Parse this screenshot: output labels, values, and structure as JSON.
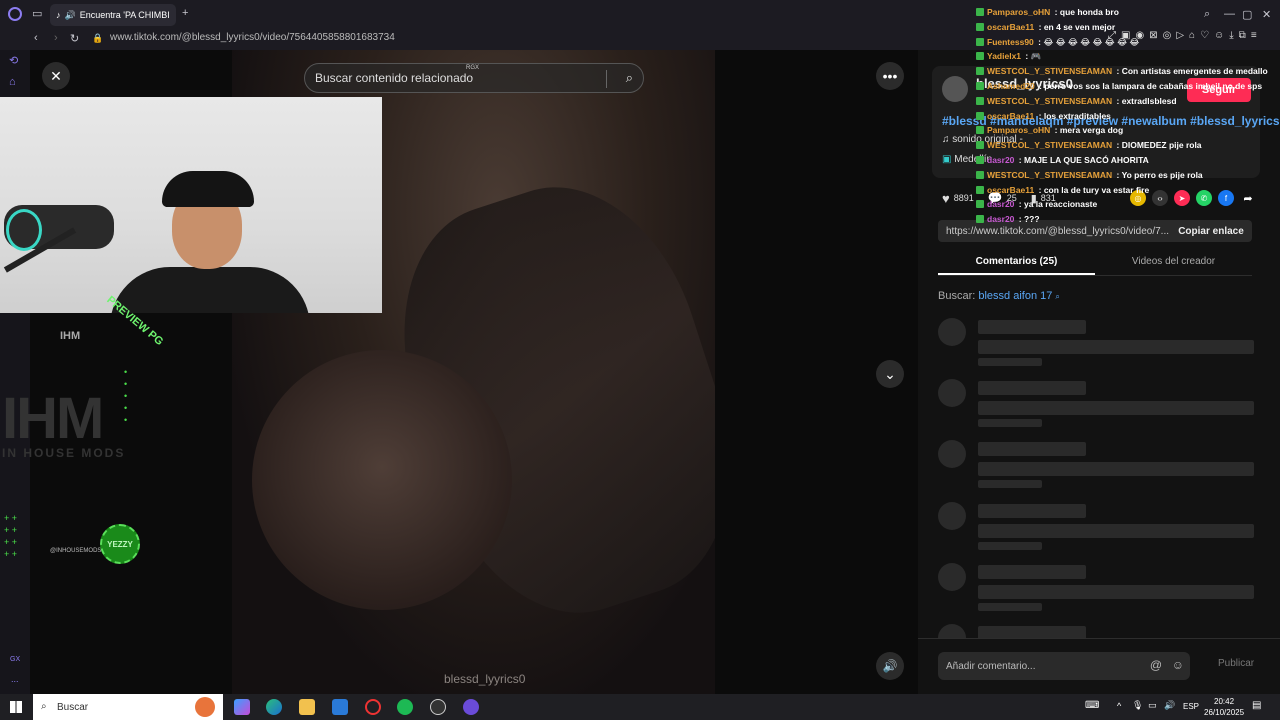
{
  "browser": {
    "tab_title": "Encuentra 'PA CHIMBI",
    "url": "www.tiktok.com/@blessd_lyyrics0/video/7564405858801683734",
    "new_tab_label": "+"
  },
  "video": {
    "search_placeholder": "Buscar contenido relacionado",
    "search_badge": "RGX",
    "watermark": "blessd_lyyrics0"
  },
  "overlay": {
    "ihm_small": "IHM",
    "ihm_big": "IHM",
    "inhouse": "IN HOUSE MODS",
    "handle": "@INHOUSEMODS",
    "yezzy": "YEZZY",
    "preview": "PREVIEW PG",
    "sidebar_gx": "GX",
    "sidebar_more": "..."
  },
  "post": {
    "username": "blessd_lyyrics0",
    "follow_label": "Seguir",
    "hashtags": "#blessd #mandelaqm #preview #newalbum #blessd_lyyrics0",
    "sound": "sonido original -",
    "medal": "Medellín",
    "likes": "8891",
    "comments": "25",
    "saves": "831",
    "link": "https://www.tiktok.com/@blessd_lyyrics0/video/7...",
    "copy_label": "Copiar enlace",
    "tab_comments": "Comentarios (25)",
    "tab_videos": "Videos del creador",
    "search_prefix": "Buscar:",
    "search_term": "blessd aifon 17",
    "comment_placeholder": "Añadir comentario...",
    "publish_label": "Publicar"
  },
  "chat": [
    {
      "user": "Pamparos_oHN",
      "text": "que honda bro",
      "color": "#e8a23a"
    },
    {
      "user": "oscarBae11",
      "text": "en 4 se ven mejor",
      "color": "#e8a23a"
    },
    {
      "user": "Fuentess90",
      "text": "😂 😂 😂 😂 😂 😂 😂 😂",
      "color": "#e8a23a"
    },
    {
      "user": "Yadielx1",
      "text": "🎮",
      "color": "#e8a23a"
    },
    {
      "user": "WESTCOL_Y_STIVENSEAMAN",
      "text": "Con artistas emergentes de medallo",
      "color": "#e8a23a"
    },
    {
      "user": "Ashamed20",
      "text": "perro vos sos la lampara de cabañas imbeil no de sps",
      "color": "#e8a23a"
    },
    {
      "user": "WESTCOL_Y_STIVENSEAMAN",
      "text": "extradlsblesd",
      "color": "#e8a23a"
    },
    {
      "user": "oscarBae11",
      "text": "los extraditables",
      "color": "#e8a23a"
    },
    {
      "user": "Pamparos_oHN",
      "text": "mera verga dog",
      "color": "#e8a23a"
    },
    {
      "user": "WESTCOL_Y_STIVENSEAMAN",
      "text": "DIOMEDEZ pije rola",
      "color": "#e8a23a"
    },
    {
      "user": "dasr20",
      "text": "MAJE LA QUE SACÓ AHORITA",
      "color": "#c85ad2"
    },
    {
      "user": "WESTCOL_Y_STIVENSEAMAN",
      "text": "Yo perro es pije rola",
      "color": "#e8a23a"
    },
    {
      "user": "oscarBae11",
      "text": "con la de tury va estar fire",
      "color": "#e8a23a"
    },
    {
      "user": "dasr20",
      "text": "ya la reaccionaste",
      "color": "#c85ad2"
    },
    {
      "user": "dasr20",
      "text": "???",
      "color": "#c85ad2"
    }
  ],
  "taskbar": {
    "search_label": "Buscar",
    "lang": "ESP",
    "time": "20:42",
    "date": "26/10/2025"
  },
  "colors": {
    "accent": "#fe2c55",
    "link": "#5aa7f5",
    "overlay_green": "#4adf4a"
  }
}
